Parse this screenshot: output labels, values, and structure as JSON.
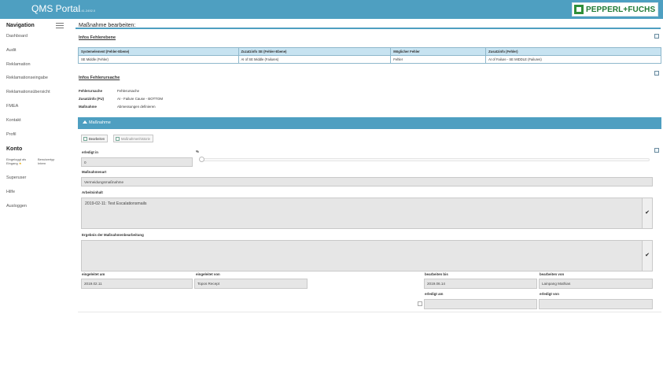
{
  "header": {
    "app_title": "QMS Portal",
    "version": "1.41.2492.0",
    "logo_text": "PEPPERL+FUCHS"
  },
  "sidebar": {
    "nav_title": "Navigation",
    "items": [
      {
        "label": "Dashboard"
      },
      {
        "label": "Audit"
      },
      {
        "label": "Reklamation"
      },
      {
        "label": "Reklamationseingabe"
      },
      {
        "label": "Reklamationsübersicht"
      },
      {
        "label": "FMEA"
      },
      {
        "label": "Kontakt"
      },
      {
        "label": "Profil"
      }
    ],
    "konto_title": "Konto",
    "login_label": "Eingeloggt als",
    "login_value": "Eingang",
    "usertype_label": "Benutzertyp",
    "usertype_value": "Intern",
    "konto_items": [
      {
        "label": "Superuser"
      },
      {
        "label": "Hilfe"
      },
      {
        "label": "Ausloggen"
      }
    ]
  },
  "page": {
    "title": "Maßnahme bearbeiten:"
  },
  "fehlerebene": {
    "link": "Infos Fehlerebene",
    "columns": [
      "Systemelement (Fehler-Ebene)",
      "Zuzatzinfo SE (Fehler-Ebene)",
      "Möglicher Fehler",
      "Zusatzinfo (Fehler)"
    ],
    "rows": [
      [
        "SE Middle (Fehler)",
        "AI of SE Middle (Failures)",
        "Fehler",
        "AI of Failure - SE MIDDLE (Failures)"
      ]
    ]
  },
  "fehlerursache": {
    "link": "Infos Fehlerursache",
    "fields": [
      {
        "label": "Fehlerursache",
        "value": "Fehlerursache"
      },
      {
        "label": "Zusatzinfo (FU)",
        "value": "AI - Failure Cause - BOTTOM"
      },
      {
        "label": "Maßnahme",
        "value": "Abmessungen definieren"
      }
    ]
  },
  "massnahme_panel": {
    "title": "Maßnahme",
    "btn_edit": "Bearbeiten",
    "btn_history": "Maßnahmenhistorie",
    "erledigt_label": "erledigt in",
    "erledigt_value": "0",
    "percent_symbol": "%",
    "slider_value": 0,
    "massnahmenart_label": "Maßnahmenart",
    "massnahmenart_value": "Vermeidungsmaßnahme",
    "arbeitsinhalt_label": "Arbeitsinhalt",
    "arbeitsinhalt_value": "2019-02-11: Test Escalationsmails",
    "ergebnis_label": "Ergebnis der Maßnahmenbearbeitung",
    "ergebnis_value": "",
    "check_symbol": "✔",
    "eingeleitet_am_label": "eingeleitet am",
    "eingeleitet_am_value": "2019.02.11",
    "eingeleitet_von_label": "eingeleitet von",
    "eingeleitet_von_value": "Topos Recept",
    "bearbeiten_bis_label": "bearbeiten bis",
    "bearbeiten_bis_value": "2019.06.14",
    "bearbeiten_von_label": "bearbeiten von",
    "bearbeiten_von_value": "Lainpang Mathias",
    "erledigt_am_label": "erledigt am",
    "erledigt_am_value": "",
    "erledigt_von_label": "erledigt von",
    "erledigt_von_value": ""
  }
}
